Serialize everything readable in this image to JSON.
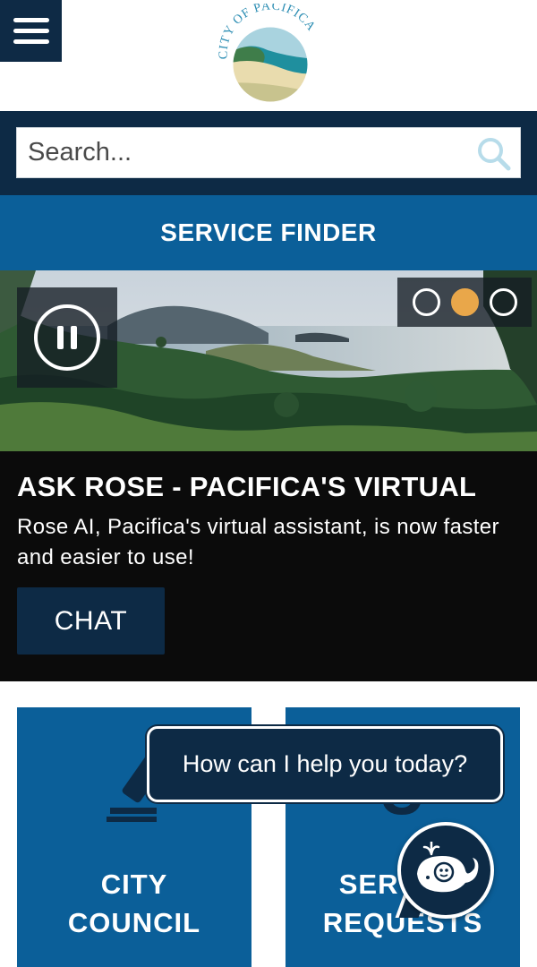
{
  "header": {
    "logo_text": "CITY OF PACIFICA"
  },
  "search": {
    "placeholder": "Search..."
  },
  "service_finder": {
    "label": "SERVICE FINDER"
  },
  "carousel": {
    "total_slides": 3,
    "active_slide": 2
  },
  "story": {
    "title": "ASK ROSE - PACIFICA'S VIRTUAL",
    "description": "Rose AI, Pacifica's virtual assistant, is now faster and easier to use!",
    "button_label": "CHAT"
  },
  "tiles": [
    {
      "line1": "CITY",
      "line2": "COUNCIL"
    },
    {
      "line1": "SERVICE",
      "line2": "REQUESTS"
    }
  ],
  "chatbot": {
    "prompt": "How can I help you today?"
  },
  "colors": {
    "navy": "#0d2a45",
    "blue": "#0b5f99",
    "accent": "#e9a74a",
    "black": "#0b0b0b"
  }
}
